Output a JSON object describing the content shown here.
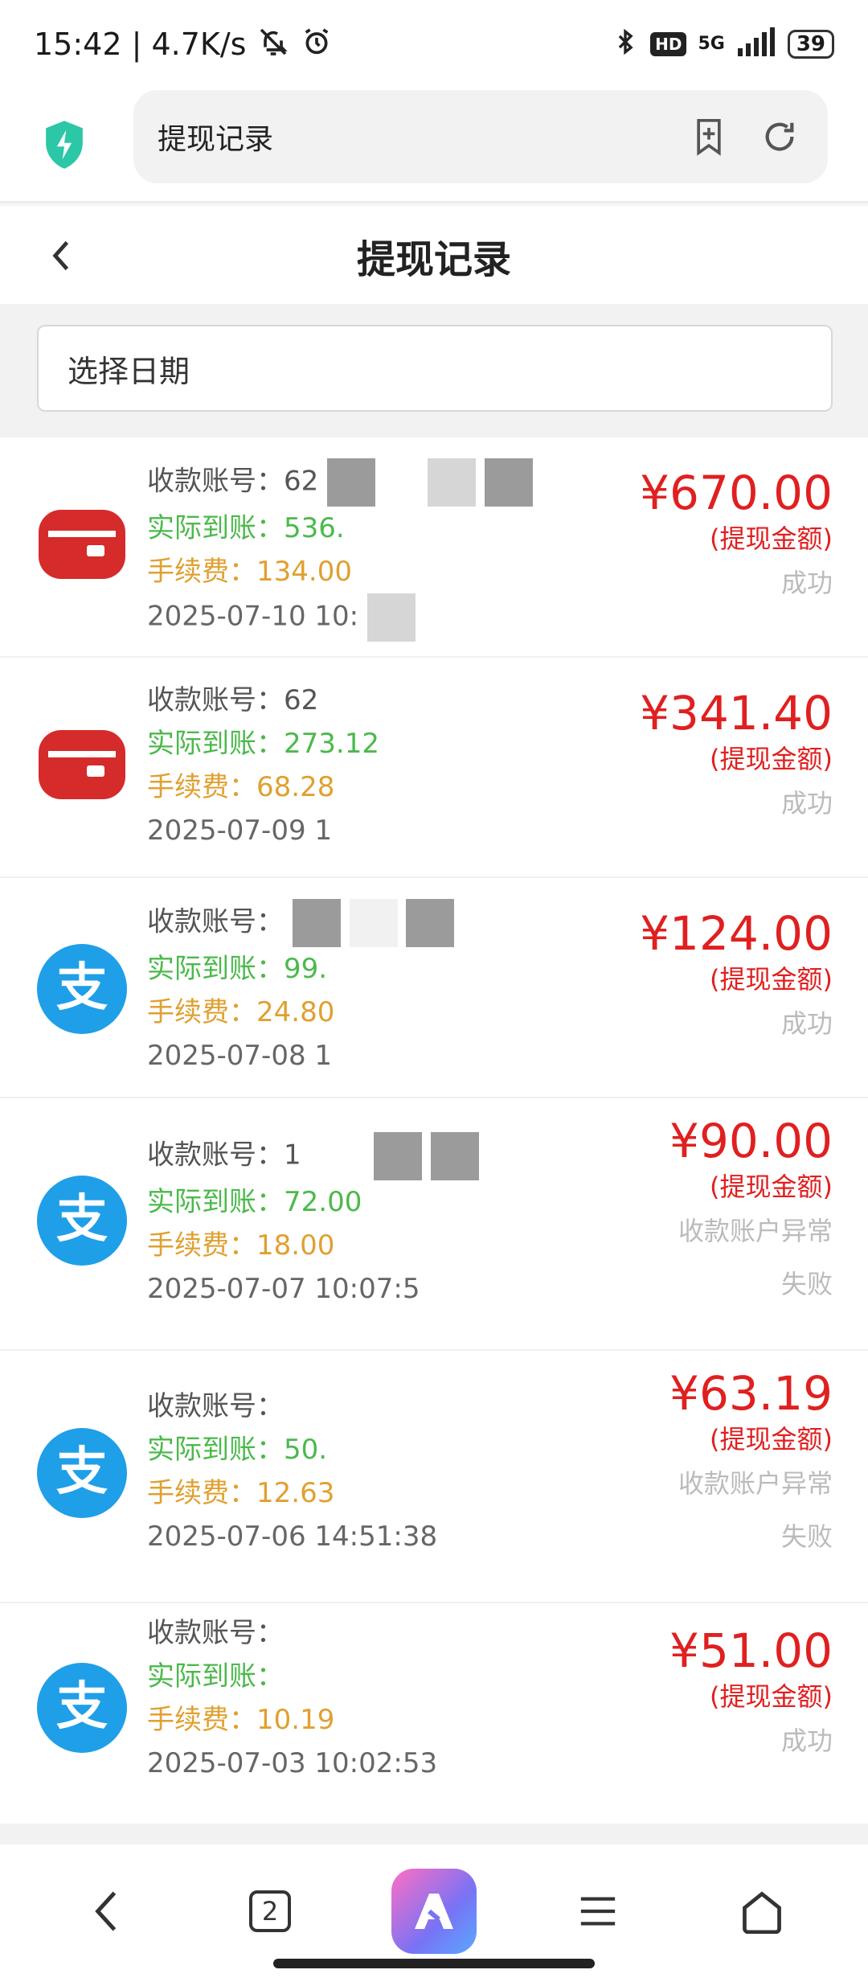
{
  "status_bar": {
    "time_speed": "15:42 | 4.7K/s",
    "network": "5G",
    "hd": "HD",
    "battery": "39"
  },
  "browser": {
    "url_title": "提现记录"
  },
  "page": {
    "title": "提现记录",
    "date_placeholder": "选择日期"
  },
  "labels": {
    "account": "收款账号：",
    "actual": "实际到账：",
    "fee": "手续费：",
    "amount_label": "(提现金额)"
  },
  "records": [
    {
      "method": "bank",
      "account": "62",
      "actual": "536.",
      "fee": "134.00",
      "time": "2025-07-10 10:",
      "amount": "¥670.00",
      "note": "",
      "status": "成功"
    },
    {
      "method": "bank",
      "account": "62",
      "actual": "273.12",
      "fee": "68.28",
      "time": "2025-07-09 1",
      "amount": "¥341.40",
      "note": "",
      "status": "成功"
    },
    {
      "method": "alipay",
      "account": "",
      "actual": "99.",
      "fee": "24.80",
      "time": "2025-07-08 1",
      "amount": "¥124.00",
      "note": "",
      "status": "成功"
    },
    {
      "method": "alipay",
      "account": "1",
      "actual": "72.00",
      "fee": "18.00",
      "time": "2025-07-07 10:07:5",
      "amount": "¥90.00",
      "note": "收款账户异常",
      "status": "失败"
    },
    {
      "method": "alipay",
      "account": "",
      "actual": "50.",
      "fee": "12.63",
      "time": "2025-07-06 14:51:38",
      "amount": "¥63.19",
      "note": "收款账户异常",
      "status": "失败"
    },
    {
      "method": "alipay",
      "account": "",
      "actual": "",
      "fee": "10.19",
      "time": "2025-07-03 10:02:53",
      "amount": "¥51.00",
      "note": "",
      "status": "成功"
    }
  ],
  "bottom_nav": {
    "tab_count": "2"
  },
  "colors": {
    "amount_red": "#e02020",
    "actual_green": "#4bb94b",
    "fee_orange": "#e0a030",
    "bank_red": "#d52b2b",
    "alipay_blue": "#1f9fe8"
  }
}
